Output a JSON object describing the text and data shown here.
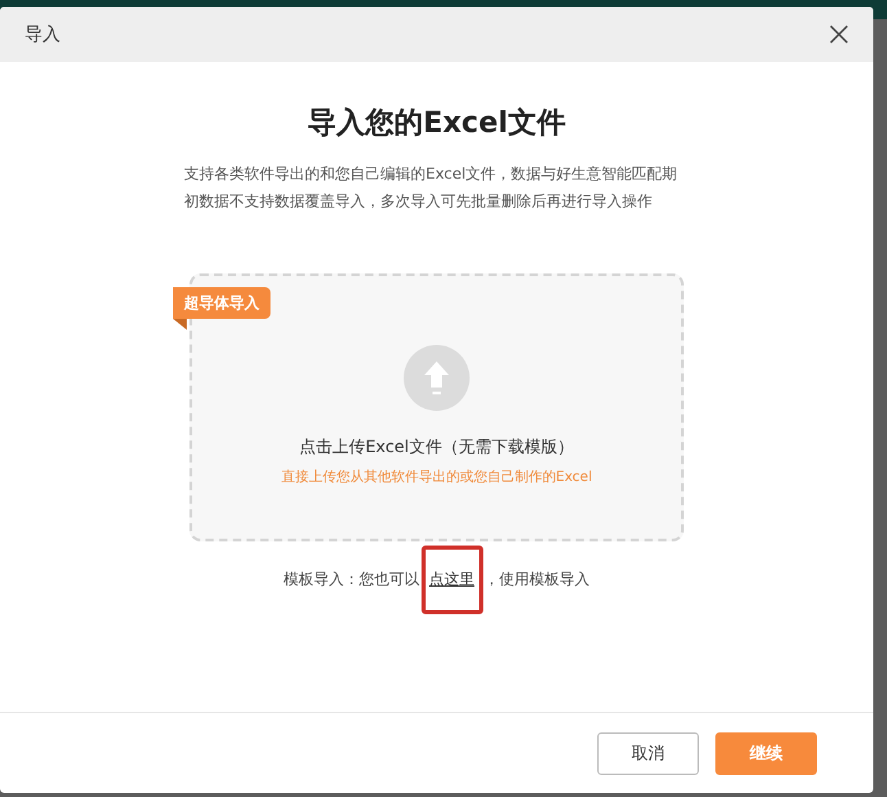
{
  "dialog": {
    "title": "导入",
    "heading": "导入您的Excel文件",
    "description": "支持各类软件导出的和您自己编辑的Excel文件，数据与好生意智能匹配期初数据不支持数据覆盖导入，多次导入可先批量删除后再进行导入操作"
  },
  "upload": {
    "badge": "超导体导入",
    "prompt": "点击上传Excel文件（无需下载模版）",
    "note": "直接上传您从其他软件导出的或您自己制作的Excel"
  },
  "template_hint": {
    "prefix": "模板导入：您也可以",
    "link": "点这里",
    "suffix": "，使用模板导入",
    "highlighted": true
  },
  "buttons": [
    {
      "label": "取消",
      "kind": "secondary"
    },
    {
      "label": "继续",
      "kind": "primary"
    }
  ]
}
